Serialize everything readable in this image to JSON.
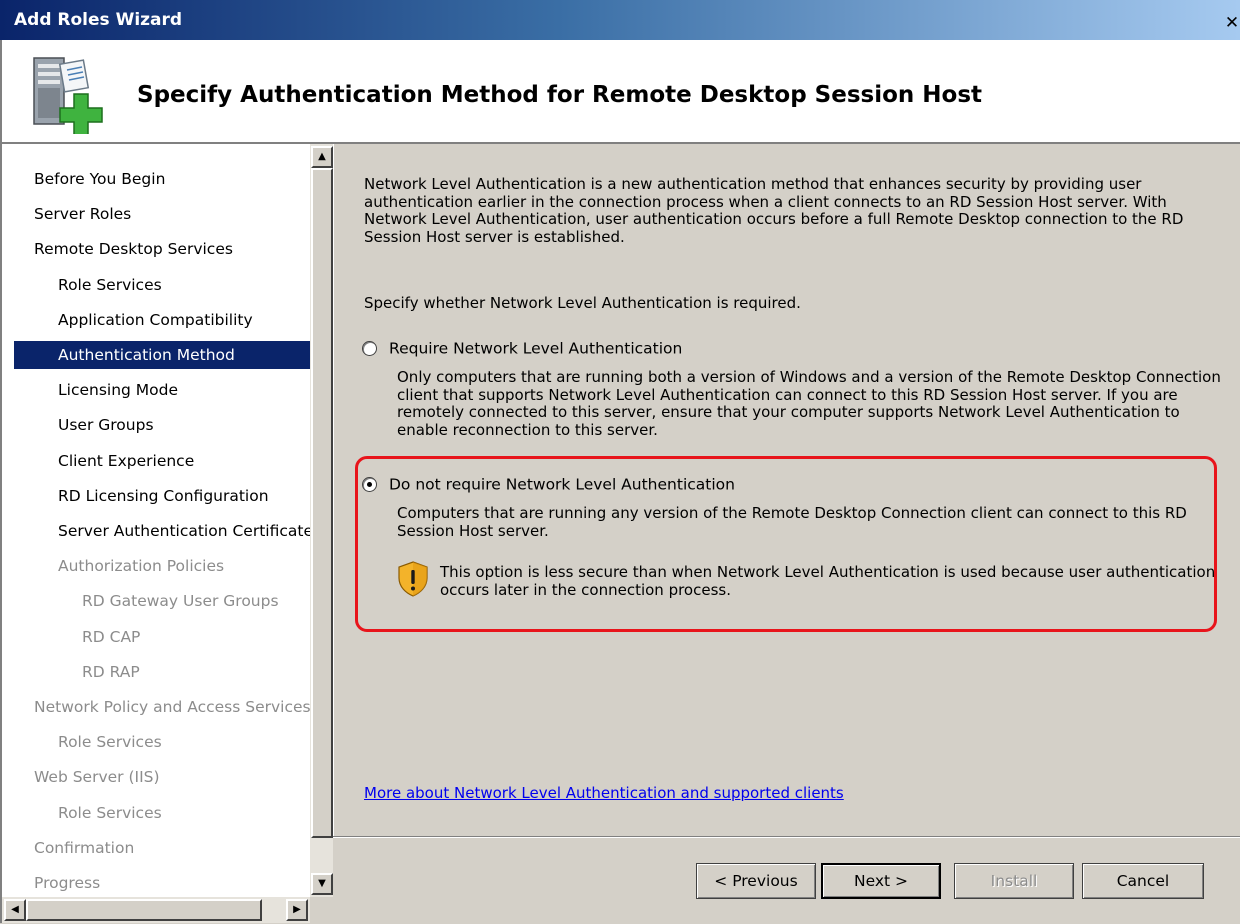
{
  "window": {
    "title": "Add Roles Wizard",
    "close_glyph": "✕"
  },
  "header": {
    "page_title": "Specify Authentication Method for Remote Desktop Session Host",
    "icon": "server-add-role-icon"
  },
  "nav": {
    "items": [
      {
        "label": "Before You Begin",
        "level": 0,
        "state": "normal"
      },
      {
        "label": "Server Roles",
        "level": 0,
        "state": "normal"
      },
      {
        "label": "Remote Desktop Services",
        "level": 0,
        "state": "normal"
      },
      {
        "label": "Role Services",
        "level": 1,
        "state": "normal"
      },
      {
        "label": "Application Compatibility",
        "level": 1,
        "state": "normal"
      },
      {
        "label": "Authentication Method",
        "level": 1,
        "state": "selected"
      },
      {
        "label": "Licensing Mode",
        "level": 1,
        "state": "normal"
      },
      {
        "label": "User Groups",
        "level": 1,
        "state": "normal"
      },
      {
        "label": "Client Experience",
        "level": 1,
        "state": "normal"
      },
      {
        "label": "RD Licensing Configuration",
        "level": 1,
        "state": "normal"
      },
      {
        "label": "Server Authentication Certificate",
        "level": 1,
        "state": "normal"
      },
      {
        "label": "Authorization Policies",
        "level": 1,
        "state": "disabled"
      },
      {
        "label": "RD Gateway User Groups",
        "level": 2,
        "state": "disabled"
      },
      {
        "label": "RD CAP",
        "level": 2,
        "state": "disabled"
      },
      {
        "label": "RD RAP",
        "level": 2,
        "state": "disabled"
      },
      {
        "label": "Network Policy and Access Services",
        "level": 0,
        "state": "disabled"
      },
      {
        "label": "Role Services",
        "level": 1,
        "state": "disabled"
      },
      {
        "label": "Web Server (IIS)",
        "level": 0,
        "state": "disabled"
      },
      {
        "label": "Role Services",
        "level": 1,
        "state": "disabled"
      },
      {
        "label": "Confirmation",
        "level": 0,
        "state": "disabled"
      },
      {
        "label": "Progress",
        "level": 0,
        "state": "disabled"
      }
    ]
  },
  "content": {
    "intro": "Network Level Authentication is a new authentication method that enhances security by providing user authentication earlier in the connection process when a client connects to an RD Session Host server. With Network Level Authentication, user authentication occurs before a full Remote Desktop connection to the RD Session Host server is established.",
    "prompt": "Specify whether Network Level Authentication is required.",
    "options": [
      {
        "label": "Require Network Level Authentication",
        "checked": false,
        "description": "Only computers that are running both a version of Windows and a version of the Remote Desktop Connection client that supports Network Level Authentication can connect to this RD Session Host server. If you are remotely connected to this server, ensure that your computer supports Network Level Authentication to enable reconnection to this server."
      },
      {
        "label": "Do not require Network Level Authentication",
        "checked": true,
        "description": "Computers that are running any version of the Remote Desktop Connection client can connect to this RD Session Host server."
      }
    ],
    "warning": "This option is less secure than when Network Level Authentication is used because user authentication occurs later in the connection process.",
    "more_link": "More about Network Level Authentication and supported clients",
    "highlight_color": "#e8141b"
  },
  "footer": {
    "previous": "< Previous",
    "next": "Next >",
    "install": "Install",
    "cancel": "Cancel"
  }
}
